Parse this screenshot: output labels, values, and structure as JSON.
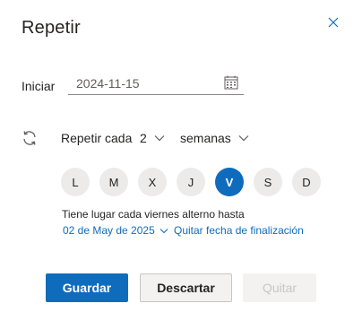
{
  "dialog": {
    "title": "Repetir",
    "close_icon": "close-icon"
  },
  "start": {
    "label": "Iniciar",
    "date_value": "2024-11-15",
    "icon": "calendar-icon"
  },
  "repeat": {
    "icon": "repeat-icon",
    "label": "Repetir cada",
    "interval": "2",
    "unit": "semanas"
  },
  "days": [
    {
      "label": "L",
      "selected": false
    },
    {
      "label": "M",
      "selected": false
    },
    {
      "label": "X",
      "selected": false
    },
    {
      "label": "J",
      "selected": false
    },
    {
      "label": "V",
      "selected": true
    },
    {
      "label": "S",
      "selected": false
    },
    {
      "label": "D",
      "selected": false
    }
  ],
  "summary": {
    "text": "Tiene lugar cada viernes alterno hasta",
    "end_date": "02 de May de 2025",
    "remove_end_link": "Quitar fecha de finalización"
  },
  "buttons": {
    "save": "Guardar",
    "discard": "Descartar",
    "remove": "Quitar"
  },
  "colors": {
    "accent": "#0f6cbd",
    "day_bg": "#edebe9",
    "text": "#252423",
    "disabled_text": "#c8c6c4"
  }
}
